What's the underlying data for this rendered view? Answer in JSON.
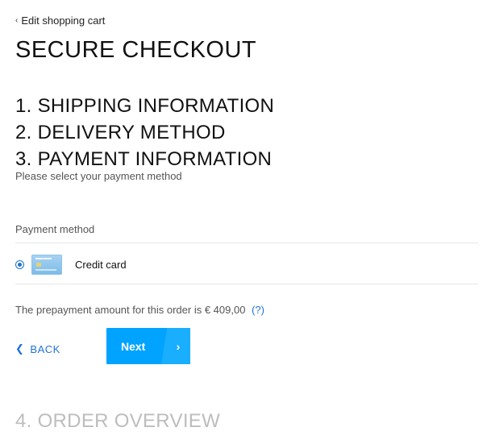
{
  "back_link": {
    "icon": "chevron-left-icon",
    "label": "Edit shopping cart"
  },
  "page_title": "SECURE CHECKOUT",
  "steps": [
    {
      "label": "1. SHIPPING INFORMATION"
    },
    {
      "label": "2. DELIVERY METHOD"
    },
    {
      "label": "3. PAYMENT INFORMATION"
    }
  ],
  "step_subtitle": "Please select your payment method",
  "payment": {
    "section_label": "Payment method",
    "options": [
      {
        "name": "Credit card",
        "icon": "credit-card-icon",
        "selected": true
      }
    ]
  },
  "prepay": {
    "text": "The prepayment amount for this order is € 409,00",
    "help": "(?)"
  },
  "buttons": {
    "back_label": "BACK",
    "back_icon": "chevron-left-icon",
    "next_label": "Next",
    "next_icon": "chevron-right-icon"
  },
  "next_step": "4. ORDER OVERVIEW",
  "colors": {
    "accent": "#00a3ff",
    "link": "#1e73d6",
    "muted": "#bdbdbd"
  }
}
